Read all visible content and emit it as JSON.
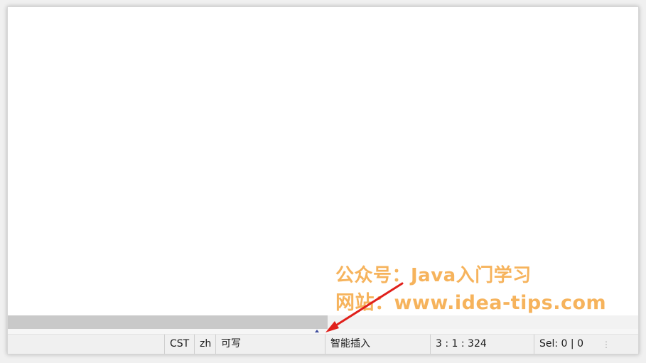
{
  "statusbar": {
    "timezone": "CST",
    "language": "zh",
    "access": "可写",
    "insert_mode": "智能插入",
    "position": "3 : 1 : 324",
    "selection": "Sel: 0 | 0"
  },
  "watermark": {
    "line1": "公众号：Java入门学习",
    "line2": "网站：www.idea-tips.com"
  },
  "colors": {
    "watermark": "#f5a846",
    "arrow": "#e0201b",
    "caret": "#3b4a9c"
  },
  "icons": {
    "caret": "triangle-up",
    "grip": "vertical-dots"
  }
}
